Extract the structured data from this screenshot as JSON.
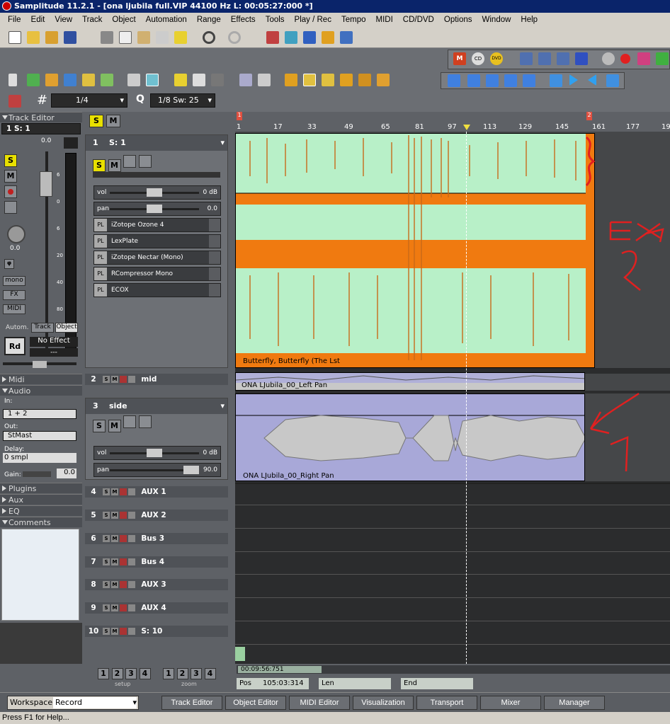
{
  "window": {
    "title": "Samplitude 11.2.1 - [ona ljubila full.VIP   44100 Hz L: 00:05:27:000 *]"
  },
  "menu": [
    "File",
    "Edit",
    "View",
    "Track",
    "Object",
    "Automation",
    "Range",
    "Effects",
    "Tools",
    "Play / Rec",
    "Tempo",
    "MIDI",
    "CD/DVD",
    "Options",
    "Window",
    "Help"
  ],
  "toolbar": {
    "grid_value": "1/4",
    "quantize_label": "Q",
    "quantize_value": "1/8 Sw: 25",
    "cd_label": "CD",
    "dvd_label": "DVD"
  },
  "track_editor": {
    "header": "Track Editor",
    "track_select": "1   S: 1",
    "fader_value": "0.0",
    "pan_value": "0.0",
    "scale": [
      "6",
      "0",
      "6",
      "20",
      "40",
      "80"
    ],
    "s_label": "S",
    "m_label": "M",
    "mono_label": "mono",
    "fx_label": "FX",
    "midi_label": "MIDI",
    "autom_label": "Autom.",
    "track_tab": "Track",
    "object_tab": "Object",
    "rd_label": "Rd",
    "no_effect": "No Effect",
    "dashes": "---",
    "sections": {
      "midi": "Midi",
      "audio": "Audio",
      "plugins": "Plugins",
      "aux": "Aux",
      "eq": "EQ",
      "comments": "Comments"
    },
    "in_label": "In:",
    "in_value": "1 + 2",
    "out_label": "Out:",
    "out_value": "StMast",
    "delay_label": "Delay:",
    "delay_value": "0 smpl",
    "gain_label": "Gain:",
    "gain_value": "0.0"
  },
  "tracks": [
    {
      "num": "1",
      "name": "S: 1",
      "vol": "0 dB",
      "pan": "0.0",
      "plugins": [
        "iZotope Ozone 4",
        "LexPlate",
        "iZotope Nectar (Mono)",
        "RCompressor Mono",
        "ECOX"
      ],
      "clip": "Butterfly, Butterfly (The Lst"
    },
    {
      "num": "2",
      "name": "mid",
      "clip": "ONA LJubila_00_Left  Pan"
    },
    {
      "num": "3",
      "name": "side",
      "vol": "0 dB",
      "pan": "90.0",
      "clip": "ONA LJubila_00_Right  Pan"
    },
    {
      "num": "4",
      "name": "AUX 1"
    },
    {
      "num": "5",
      "name": "AUX 2"
    },
    {
      "num": "6",
      "name": "Bus 3"
    },
    {
      "num": "7",
      "name": "Bus 4"
    },
    {
      "num": "8",
      "name": "AUX 3"
    },
    {
      "num": "9",
      "name": "AUX 4"
    },
    {
      "num": "10",
      "name": "S: 10"
    }
  ],
  "labels": {
    "vol": "vol",
    "pan": "pan",
    "pl": "PL",
    "s": "S",
    "m": "M"
  },
  "ruler": {
    "marks": [
      "1",
      "17",
      "33",
      "49",
      "65",
      "81",
      "97",
      "113",
      "129",
      "145",
      "161",
      "177",
      "19"
    ],
    "marker1": "1",
    "marker2": "2"
  },
  "bottom": {
    "setup_buttons": [
      "1",
      "2",
      "3",
      "4"
    ],
    "setup_label": "setup",
    "zoom_buttons": [
      "1",
      "2",
      "3",
      "4"
    ],
    "zoom_label": "zoom",
    "time_display": "00:09:56:751",
    "pos_label": "Pos",
    "pos_value": "105:03:314",
    "len_label": "Len",
    "end_label": "End"
  },
  "workspace": {
    "label": "Workspace:",
    "value": "Record",
    "tabs": [
      "Track Editor",
      "Object Editor",
      "MIDI Editor",
      "Visualization",
      "Transport",
      "Mixer",
      "Manager"
    ]
  },
  "status": "Press F1 for Help...",
  "annotations": {
    "a1": "EXA",
    "a2": "2",
    "a3": "1"
  },
  "colors": {
    "accent_orange": "#f07a10",
    "wave_green": "#b8f0c8",
    "wave_purple": "#a8a8d8",
    "solo_yellow": "#e8e000"
  }
}
